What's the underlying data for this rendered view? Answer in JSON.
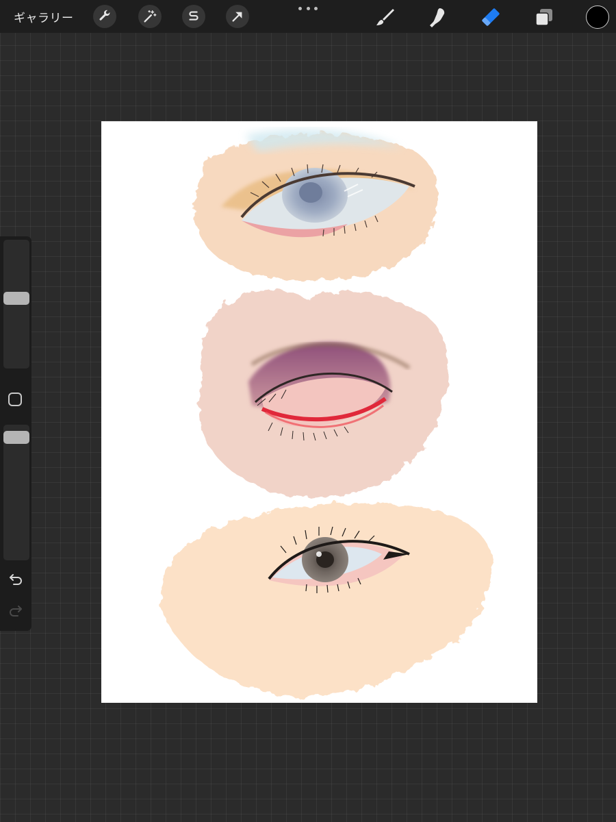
{
  "toolbar": {
    "gallery_label": "ギャラリー",
    "left_tools": [
      {
        "name": "actions",
        "icon": "wrench-icon"
      },
      {
        "name": "adjustments",
        "icon": "magic-wand-icon"
      },
      {
        "name": "selection",
        "icon": "selection-s-icon"
      },
      {
        "name": "transform",
        "icon": "arrow-cursor-icon"
      }
    ],
    "more_icon": "ellipsis-icon",
    "right_tools": [
      {
        "name": "brush",
        "icon": "brush-icon",
        "active": false
      },
      {
        "name": "smudge",
        "icon": "smudge-finger-icon",
        "active": false
      },
      {
        "name": "eraser",
        "icon": "eraser-icon",
        "active": true
      },
      {
        "name": "layers",
        "icon": "layers-icon",
        "active": false
      }
    ],
    "active_color": "#000000",
    "accent_color": "#1e7cf2"
  },
  "sidebar": {
    "brush_size_level": 0.55,
    "opacity_level": 0.95,
    "modify_icon": "square-icon",
    "undo_icon": "undo-arrow-icon",
    "redo_icon": "redo-arrow-icon",
    "redo_enabled": false
  },
  "canvas": {
    "background": "#ffffff",
    "artwork": [
      "eye-sketch-top",
      "eye-sketch-middle-closed",
      "eye-sketch-bottom"
    ]
  }
}
